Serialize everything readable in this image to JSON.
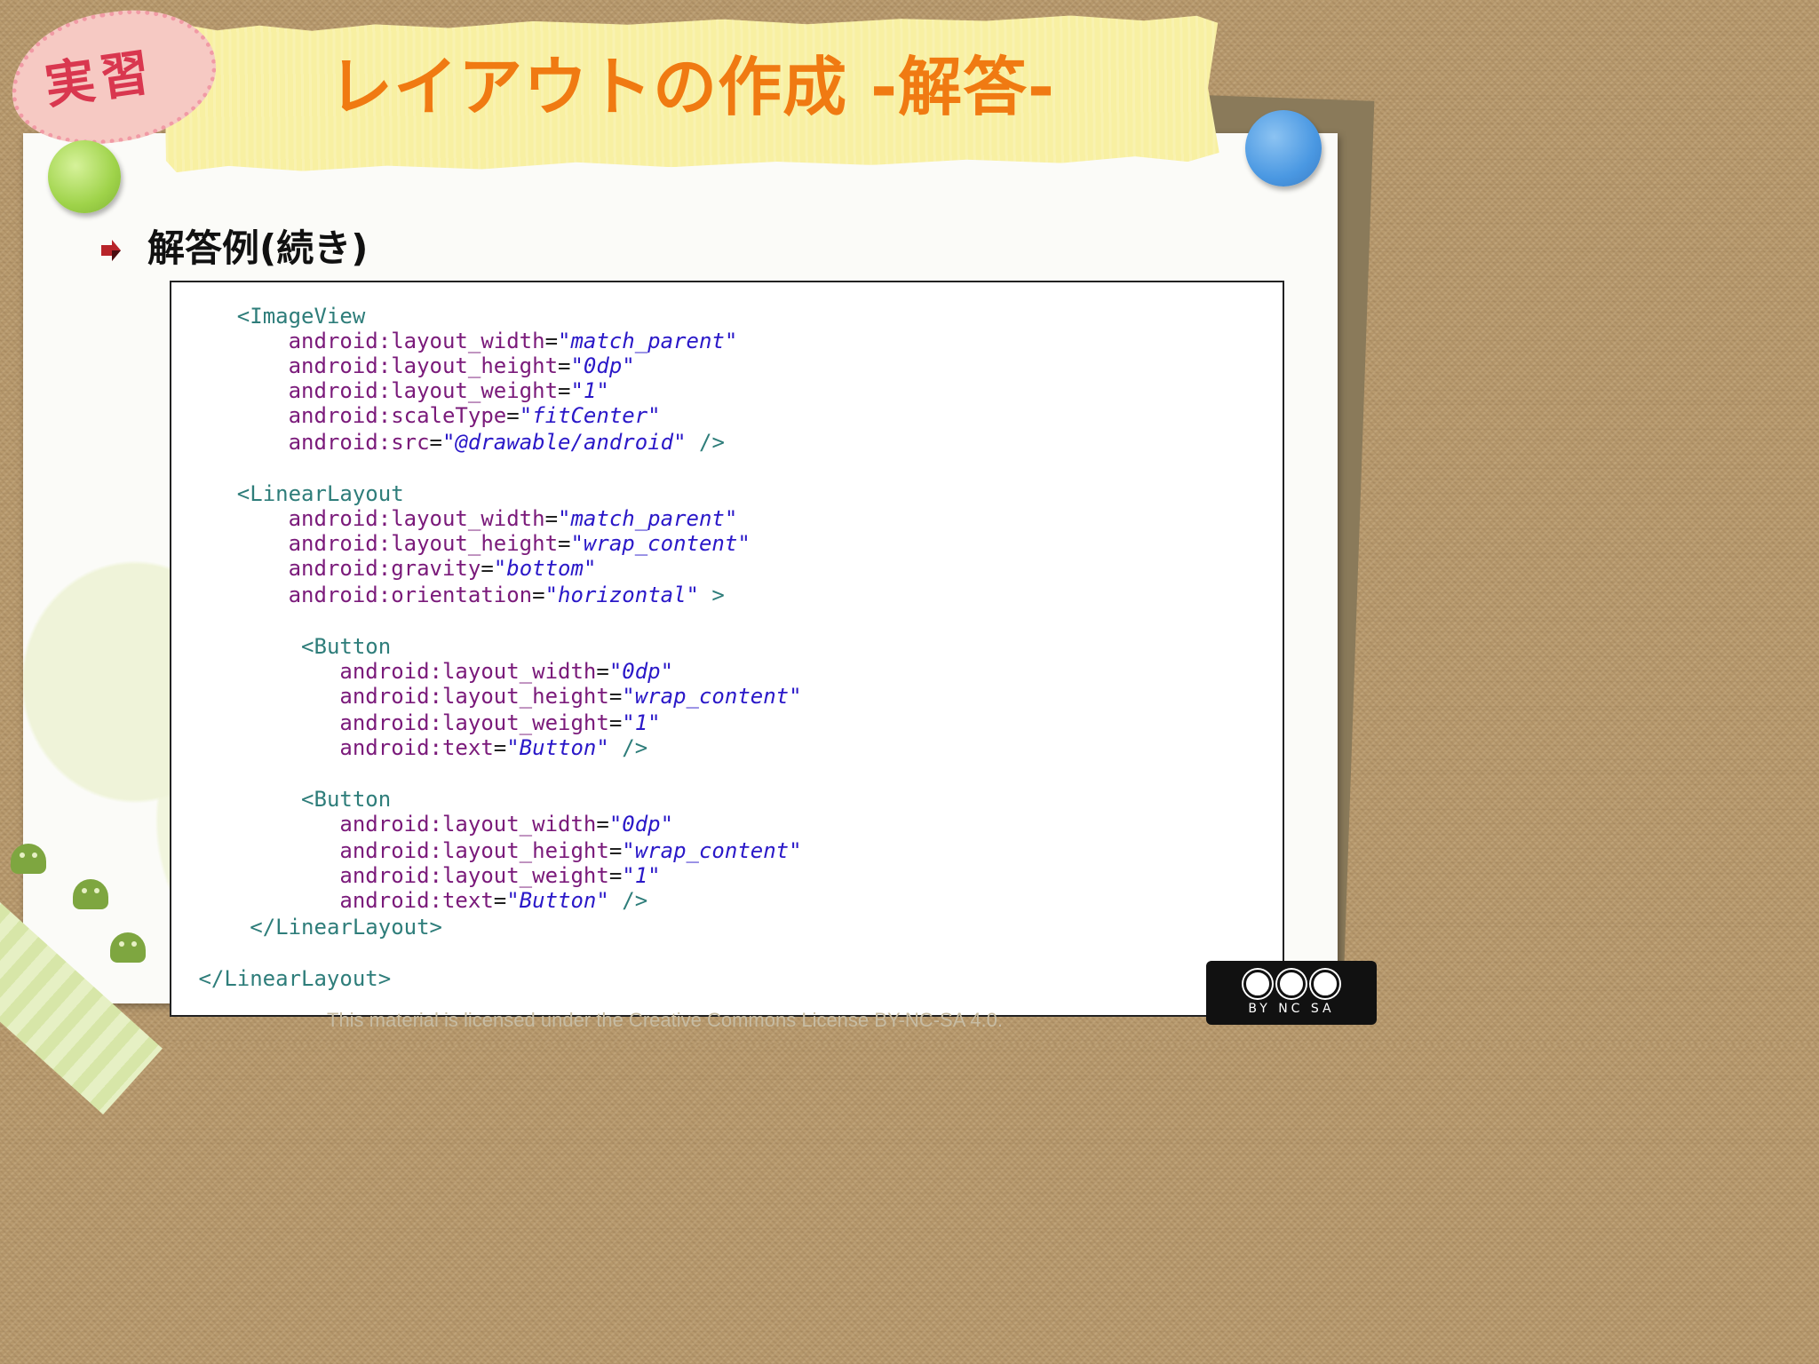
{
  "title": "レイアウトの作成 -解答-",
  "badge": "実習",
  "section": {
    "heading": "解答例(続き)"
  },
  "code_lines": [
    {
      "indent": 2,
      "tag": "<ImageView"
    },
    {
      "indent": 4,
      "attr": "android:layout_width",
      "value": "\"match_parent\""
    },
    {
      "indent": 4,
      "attr": "android:layout_height",
      "value": "\"0dp\""
    },
    {
      "indent": 4,
      "attr": "android:layout_weight",
      "value": "\"1\""
    },
    {
      "indent": 4,
      "attr": "android:scaleType",
      "value": "\"fitCenter\""
    },
    {
      "indent": 4,
      "attr": "android:src",
      "value": "\"@drawable/android\"",
      "close": " />"
    },
    {
      "blank": true
    },
    {
      "indent": 2,
      "tag": "<LinearLayout"
    },
    {
      "indent": 4,
      "attr": "android:layout_width",
      "value": "\"match_parent\""
    },
    {
      "indent": 4,
      "attr": "android:layout_height",
      "value": "\"wrap_content\""
    },
    {
      "indent": 4,
      "attr": "android:gravity",
      "value": "\"bottom\""
    },
    {
      "indent": 4,
      "attr": "android:orientation",
      "value": "\"horizontal\"",
      "close": " >"
    },
    {
      "blank": true
    },
    {
      "indent": 4.5,
      "tag": "<Button"
    },
    {
      "indent": 6,
      "attr": "android:layout_width",
      "value": "\"0dp\""
    },
    {
      "indent": 6,
      "attr": "android:layout_height",
      "value": "\"wrap_content\""
    },
    {
      "indent": 6,
      "attr": "android:layout_weight",
      "value": "\"1\""
    },
    {
      "indent": 6,
      "attr": "android:text",
      "value": "\"Button\"",
      "close": " />"
    },
    {
      "blank": true
    },
    {
      "indent": 4.5,
      "tag": "<Button"
    },
    {
      "indent": 6,
      "attr": "android:layout_width",
      "value": "\"0dp\""
    },
    {
      "indent": 6,
      "attr": "android:layout_height",
      "value": "\"wrap_content\""
    },
    {
      "indent": 6,
      "attr": "android:layout_weight",
      "value": "\"1\""
    },
    {
      "indent": 6,
      "attr": "android:text",
      "value": "\"Button\"",
      "close": " />"
    },
    {
      "indent": 2.5,
      "tag": "</LinearLayout>"
    },
    {
      "blank": true
    },
    {
      "indent": 0.5,
      "tag": "</LinearLayout>"
    }
  ],
  "footer": {
    "license_text": "This material is licensed under the Creative Commons License BY-NC-SA 4.0."
  },
  "cc_badge": {
    "label": "BY NC SA"
  },
  "colors": {
    "title": "#f07a12",
    "tag": "#2e7d7a",
    "attr": "#7a1a7a",
    "value": "#2a18c8"
  }
}
